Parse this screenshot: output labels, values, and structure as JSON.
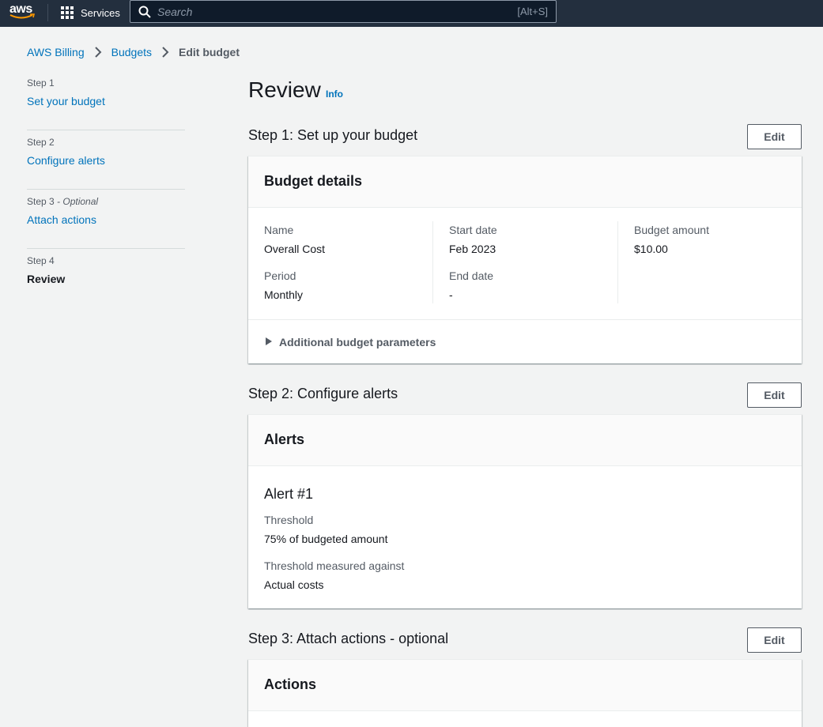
{
  "topnav": {
    "logo_text": "aws",
    "services_label": "Services",
    "search_placeholder": "Search",
    "search_shortcut": "[Alt+S]"
  },
  "breadcrumb": {
    "items": [
      "AWS Billing",
      "Budgets"
    ],
    "current": "Edit budget"
  },
  "steps": [
    {
      "num": "Step 1",
      "optional": "",
      "title": "Set your budget"
    },
    {
      "num": "Step 2",
      "optional": "",
      "title": "Configure alerts"
    },
    {
      "num": "Step 3",
      "optional": " - Optional",
      "title": "Attach actions"
    },
    {
      "num": "Step 4",
      "optional": "",
      "title": "Review"
    }
  ],
  "page": {
    "title": "Review",
    "info": "Info"
  },
  "section1": {
    "header": "Step 1: Set up your budget",
    "edit": "Edit",
    "container_title": "Budget details",
    "name_label": "Name",
    "name_value": "Overall Cost",
    "period_label": "Period",
    "period_value": "Monthly",
    "start_label": "Start date",
    "start_value": "Feb 2023",
    "end_label": "End date",
    "end_value": "-",
    "amount_label": "Budget amount",
    "amount_value": "$10.00",
    "expander": "Additional budget parameters"
  },
  "section2": {
    "header": "Step 2: Configure alerts",
    "edit": "Edit",
    "container_title": "Alerts",
    "alert_title": "Alert #1",
    "threshold_label": "Threshold",
    "threshold_value": "75% of budgeted amount",
    "measured_label": "Threshold measured against",
    "measured_value": "Actual costs"
  },
  "section3": {
    "header": "Step 3: Attach actions - optional",
    "edit": "Edit",
    "container_title": "Actions"
  },
  "colors": {
    "nav_bg": "#232f3e",
    "link": "#0073bb",
    "aws_orange": "#ff9900",
    "page_bg": "#f2f3f3"
  }
}
